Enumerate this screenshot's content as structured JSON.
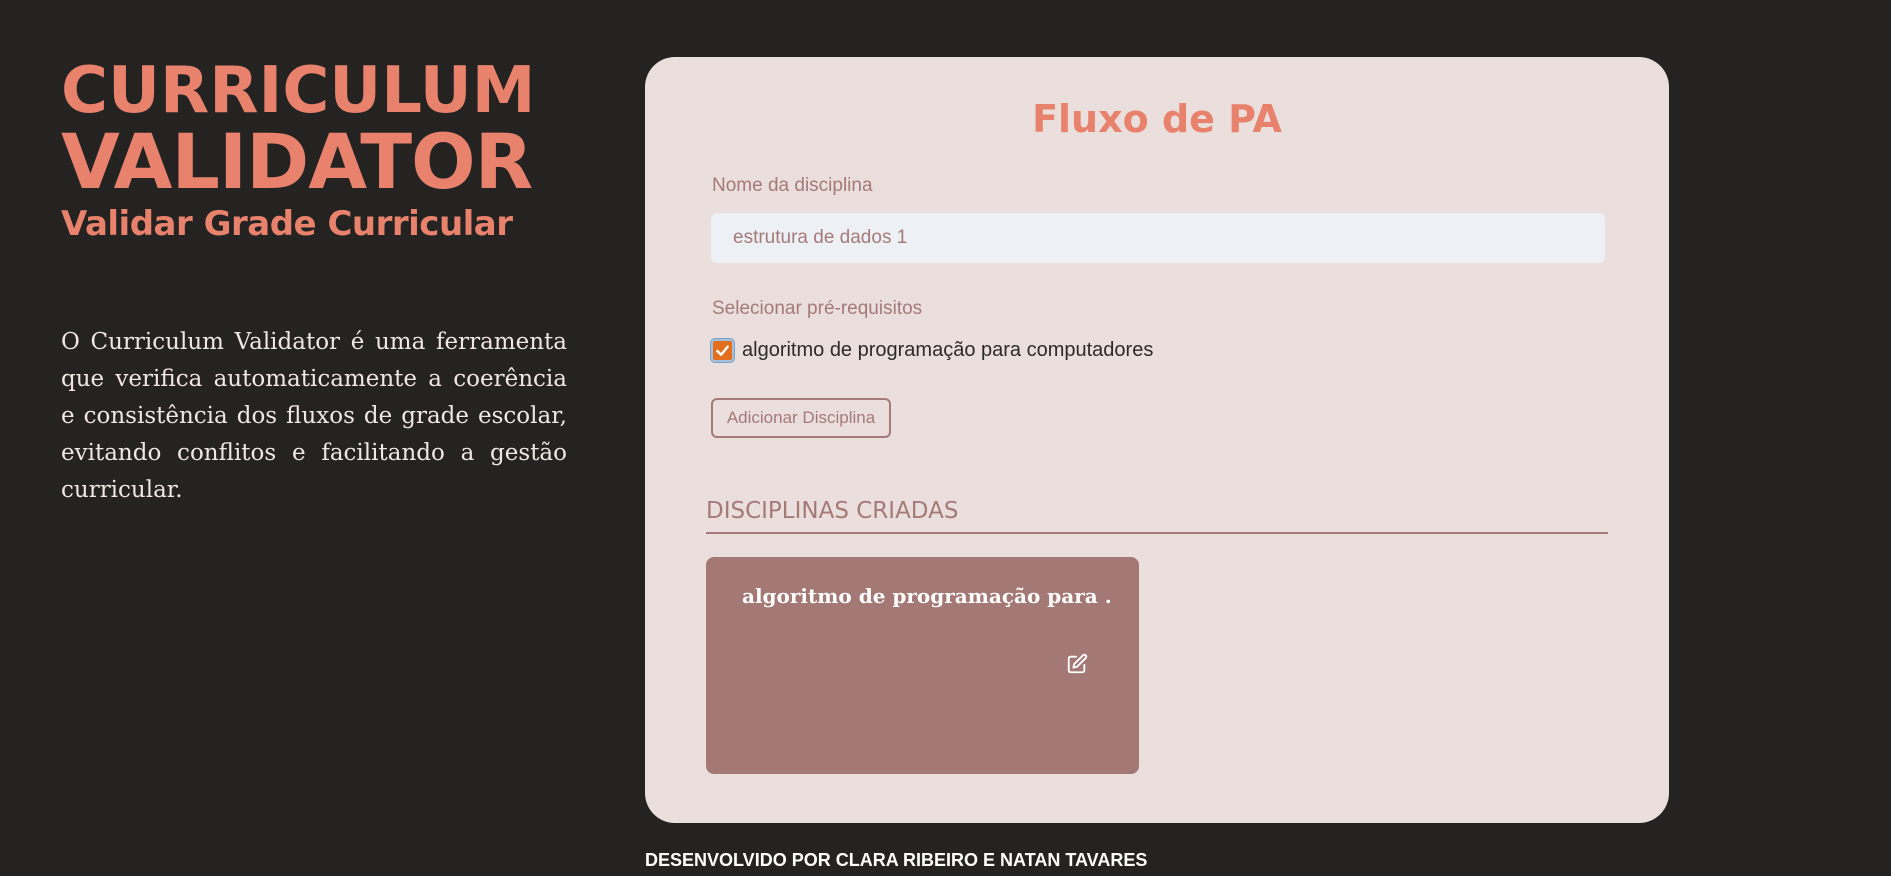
{
  "brand": {
    "line1": "CURRICULUM",
    "line2": "VALIDATOR",
    "subtitle": "Validar Grade Curricular",
    "description": "O Curriculum Validator é uma ferramenta que verifica automaticamente a coerência e consistência dos fluxos de grade escolar, evitando conflitos e facilitando a gestão curricular."
  },
  "form": {
    "title": "Fluxo de PA",
    "name_label": "Nome da disciplina",
    "name_value": "estrutura de dados 1",
    "prereq_label": "Selecionar pré-requisitos",
    "prereq_options": [
      {
        "label": "algoritmo de programação para computadores",
        "checked": true
      }
    ],
    "add_button": "Adicionar Disciplina"
  },
  "created": {
    "section_title": "DISCIPLINAS CRIADAS",
    "cards": [
      {
        "title": "algoritmo de programação para ...",
        "icon": "edit-icon"
      }
    ]
  },
  "footer": {
    "credit": "DESENVOLVIDO POR CLARA RIBEIRO E NATAN TAVARES"
  },
  "colors": {
    "background": "#242322",
    "accent": "#e8826c",
    "card_bg": "#eadfdc",
    "muted": "#a57a78",
    "subject_card": "#a47874",
    "checkbox": "#e36f1e"
  }
}
